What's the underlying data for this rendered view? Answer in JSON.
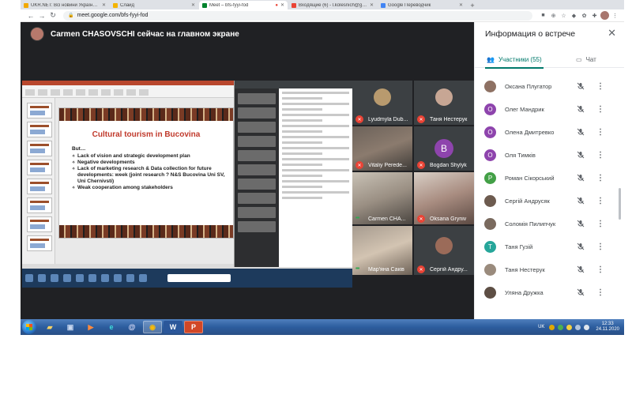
{
  "browser": {
    "tabs": [
      {
        "title": "UKR.NET: Всі новини України, ...",
        "color": "#f2a900",
        "active": false
      },
      {
        "title": "Слайд",
        "color": "#f4b400",
        "active": false
      },
      {
        "title": "Meet – bfs-fyyi-fod",
        "color": "#00832d",
        "active": true
      },
      {
        "title": "Входящие (6) - l.kolesnich@gm...",
        "color": "#ea4335",
        "active": false
      },
      {
        "title": "Google Переводчик",
        "color": "#4285f4",
        "active": false
      }
    ],
    "url": "meet.google.com/bfs-fyyi-fod"
  },
  "stage": {
    "presenter_text": "Carmen CHASOVSCHI сейчас на главном экране"
  },
  "slide": {
    "title": "Cultural tourism in Bucovina",
    "lead": "But…",
    "bullets": [
      "Lack of vision and strategic development plan",
      "Negative developments",
      "Lack of marketing research & Data collection for future developments: week (joint research ? N&S Bucovina Uni SV, Uni Chernivsti)",
      "Weak cooperation among stakeholders"
    ]
  },
  "tiles": [
    {
      "name": "Lyudmyla Dub...",
      "muted": true
    },
    {
      "name": "Таня Нестерук",
      "muted": true
    },
    {
      "name": "Vitaliy Perede...",
      "muted": true
    },
    {
      "name": "Bogdan Shylyk",
      "muted": true,
      "letter": "B"
    },
    {
      "name": "Carmen CHA...",
      "muted": false
    },
    {
      "name": "Oksana Gryniv",
      "muted": true
    },
    {
      "name": "Мар'яна Саків",
      "muted": true
    },
    {
      "name": "Сергій Андру...",
      "muted": true
    }
  ],
  "taskbar": {
    "lang": "UK",
    "time": "12:33",
    "date": "24.11.2020"
  },
  "side": {
    "title": "Информация о встрече",
    "tab_people": "Участники (55)",
    "tab_chat": "Чат",
    "participants": [
      {
        "name": "Оксана Плугатор",
        "avatar": "#8e7163",
        "letter": ""
      },
      {
        "name": "Олег Мандрик",
        "avatar": "#8e44ad",
        "letter": "О"
      },
      {
        "name": "Олена Дмитревко",
        "avatar": "#8e44ad",
        "letter": "О"
      },
      {
        "name": "Оля Тимків",
        "avatar": "#8e44ad",
        "letter": "О"
      },
      {
        "name": "Роман Сікорський",
        "avatar": "#43a047",
        "letter": "Р"
      },
      {
        "name": "Сергій Андрусяк",
        "avatar": "#6d5b4f",
        "letter": ""
      },
      {
        "name": "Соломія Пилипчук",
        "avatar": "#7a6a5e",
        "letter": ""
      },
      {
        "name": "Таня Гузій",
        "avatar": "#26a69a",
        "letter": "Т"
      },
      {
        "name": "Таня Нестерук",
        "avatar": "#9a8b7d",
        "letter": ""
      },
      {
        "name": "Уляна Дружка",
        "avatar": "#5d4e44",
        "letter": ""
      }
    ]
  }
}
